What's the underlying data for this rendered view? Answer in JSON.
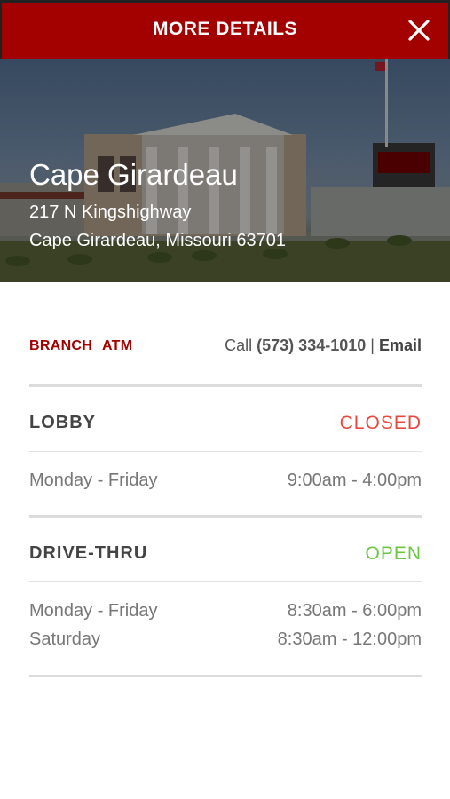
{
  "header": {
    "title": "MORE DETAILS",
    "close_icon": "close-icon"
  },
  "branch": {
    "name": "Cape Girardeau",
    "address_line1": "217 N Kingshighway",
    "address_line2": "Cape Girardeau, Missouri 63701"
  },
  "tags": {
    "branch": "BRANCH",
    "atm": "ATM"
  },
  "contact": {
    "call_label": "Call",
    "phone": "(573) 334-1010",
    "separator": "|",
    "email_label": "Email"
  },
  "lobby": {
    "title": "LOBBY",
    "status": "CLOSED",
    "status_color": "#e8483f",
    "hours": [
      {
        "day": "Monday - Friday",
        "time": "9:00am - 4:00pm"
      }
    ]
  },
  "drive_thru": {
    "title": "DRIVE-THRU",
    "status": "OPEN",
    "status_color": "#6cc644",
    "hours": [
      {
        "day": "Monday - Friday",
        "time": "8:30am - 6:00pm"
      },
      {
        "day": "Saturday",
        "time": "8:30am - 12:00pm"
      }
    ]
  },
  "colors": {
    "brand": "#a30000"
  }
}
